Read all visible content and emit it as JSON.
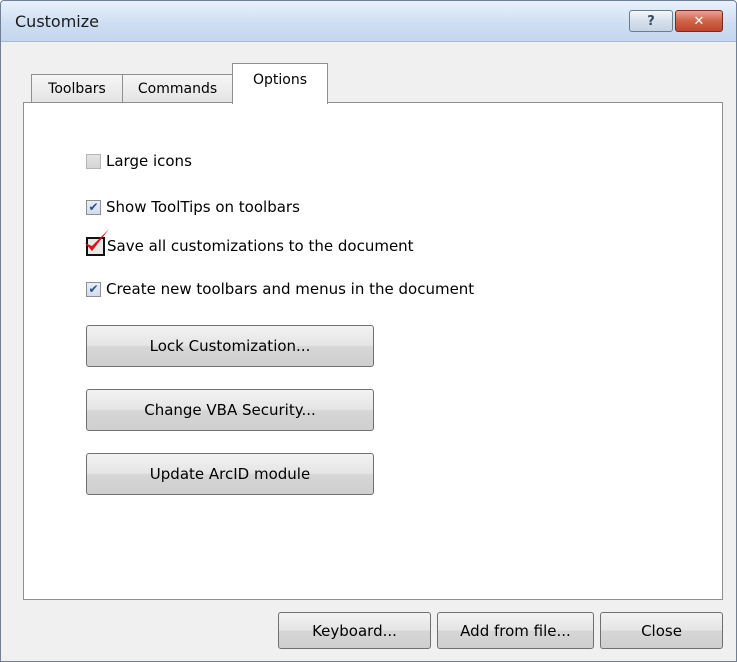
{
  "window": {
    "title": "Customize",
    "help_glyph": "?",
    "close_glyph": "✕"
  },
  "tabs": [
    {
      "label": "Toolbars"
    },
    {
      "label": "Commands"
    },
    {
      "label": "Options"
    }
  ],
  "options": [
    {
      "label": "Large icons",
      "checked": false
    },
    {
      "label": "Show ToolTips on toolbars",
      "checked": true
    },
    {
      "label": "Save all customizations to the document",
      "checked": false
    },
    {
      "label": "Create new toolbars and menus in the document",
      "checked": true
    }
  ],
  "panel_buttons": [
    {
      "label": "Lock Customization..."
    },
    {
      "label": "Change VBA Security..."
    },
    {
      "label": "Update ArcID module"
    }
  ],
  "footer_buttons": [
    {
      "label": "Keyboard..."
    },
    {
      "label": "Add from file..."
    },
    {
      "label": "Close"
    }
  ],
  "colors": {
    "annotation_check": "#e01010",
    "check_glyph": "#2a4f95"
  },
  "check_glyph": "✔"
}
